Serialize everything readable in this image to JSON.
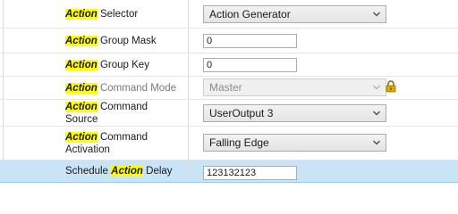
{
  "properties": [
    {
      "highlight": "Action",
      "rest": " Selector",
      "control": "combo",
      "value": "Action Generator"
    },
    {
      "highlight": "Action",
      "rest": " Group Mask",
      "control": "field",
      "value": "0"
    },
    {
      "highlight": "Action",
      "rest": " Group Key",
      "control": "field",
      "value": "0"
    },
    {
      "highlight": "Action",
      "rest": " Command Mode",
      "control": "combo-disabled",
      "value": "Master"
    },
    {
      "highlight": "Action",
      "rest": " Command\nSource",
      "control": "combo",
      "value": "UserOutput 3"
    },
    {
      "highlight": "Action",
      "rest": " Command\nActivation",
      "control": "combo",
      "value": "Falling Edge"
    },
    {
      "prefix": "Schedule ",
      "highlight": "Action",
      "rest": " Delay",
      "control": "field",
      "value": "123132123"
    }
  ],
  "colors": {
    "highlight": "#ffff00",
    "selected_row": "#c9e3f7",
    "lock_icon": "#e0a800"
  }
}
